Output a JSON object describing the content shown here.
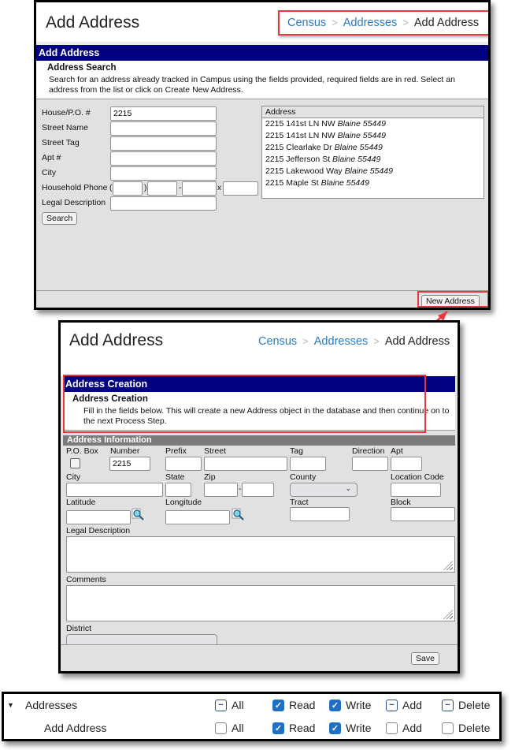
{
  "search_panel": {
    "page_title": "Add Address",
    "breadcrumb": [
      "Census",
      "Addresses",
      "Add Address"
    ],
    "nav_title": "Add Address",
    "section_title": "Address Search",
    "section_desc": "Search for an address already tracked in Campus using the fields provided, required fields are in red. Select an address from the list or click on Create New Address.",
    "fields": [
      {
        "label": "House/P.O. #",
        "value": "2215"
      },
      {
        "label": "Street Name",
        "value": ""
      },
      {
        "label": "Street Tag",
        "value": ""
      },
      {
        "label": "Apt #",
        "value": ""
      },
      {
        "label": "City",
        "value": ""
      },
      {
        "label": "Household Phone",
        "value": ""
      },
      {
        "label": "Legal Description",
        "value": ""
      }
    ],
    "phone_symbols": {
      "open": "(",
      "close": ")",
      "dash": "-",
      "ext": "x"
    },
    "search_button": "Search",
    "results_header": "Address",
    "results": [
      {
        "street": "2215 141st LN NW",
        "city_zip": "Blaine 55449"
      },
      {
        "street": "2215 141st LN NW",
        "city_zip": "Blaine 55449"
      },
      {
        "street": "2215 Clearlake Dr",
        "city_zip": "Blaine 55449"
      },
      {
        "street": "2215 Jefferson St",
        "city_zip": "Blaine 55449"
      },
      {
        "street": "2215 Lakewood Way",
        "city_zip": "Blaine 55449"
      },
      {
        "street": "2215 Maple St",
        "city_zip": "Blaine 55449"
      }
    ],
    "new_address_button": "New Address"
  },
  "creation_panel": {
    "page_title": "Add Address",
    "breadcrumb": [
      "Census",
      "Addresses",
      "Add Address"
    ],
    "nav_title": "Address Creation",
    "section_title": "Address Creation",
    "section_desc": "Fill in the fields below. This will create a new Address object in the database and then continue on to the next Process Step.",
    "info_header": "Address Information",
    "labels": {
      "po_box": "P.O. Box",
      "number": "Number",
      "prefix": "Prefix",
      "street": "Street",
      "tag": "Tag",
      "direction": "Direction",
      "apt": "Apt",
      "city": "City",
      "state": "State",
      "zip": "Zip",
      "county": "County",
      "location_code": "Location Code",
      "latitude": "Latitude",
      "longitude": "Longitude",
      "tract": "Tract",
      "block": "Block",
      "legal_description": "Legal Description",
      "comments": "Comments",
      "district": "District",
      "zip_dash": "-"
    },
    "values": {
      "number": "2215",
      "po_box_checked": false
    },
    "save_button": "Save"
  },
  "permissions": {
    "rows": [
      {
        "name": "Addresses",
        "expanded": true,
        "perms": [
          {
            "label": "All",
            "state": "partial"
          },
          {
            "label": "Read",
            "state": "checked"
          },
          {
            "label": "Write",
            "state": "checked"
          },
          {
            "label": "Add",
            "state": "partial"
          },
          {
            "label": "Delete",
            "state": "partial"
          }
        ]
      },
      {
        "name": "Add Address",
        "expanded": null,
        "perms": [
          {
            "label": "All",
            "state": "empty"
          },
          {
            "label": "Read",
            "state": "checked"
          },
          {
            "label": "Write",
            "state": "checked"
          },
          {
            "label": "Add",
            "state": "empty"
          },
          {
            "label": "Delete",
            "state": "empty"
          }
        ]
      }
    ],
    "expand_icon": "▼"
  },
  "colors": {
    "nav_bg": "#000080",
    "link": "#2a7bc2",
    "highlight": "#e8383d",
    "check": "#1f6fc2"
  }
}
